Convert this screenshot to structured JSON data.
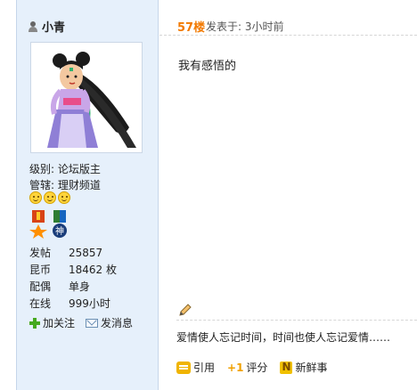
{
  "user": {
    "name": "小青",
    "level": "级别: 论坛版主",
    "manage": "管辖: 理财频道",
    "stats": [
      {
        "key": "发帖",
        "value": "25857"
      },
      {
        "key": "昆币",
        "value": "18462 枚"
      },
      {
        "key": "配偶",
        "value": "单身"
      },
      {
        "key": "在线",
        "value": "999小时"
      }
    ],
    "actions": {
      "follow": "加关注",
      "message": "发消息"
    },
    "medal_text": "神"
  },
  "post": {
    "floor": "57楼",
    "posted_time": "发表于: 3小时前",
    "content": "我有感悟的",
    "signature": "爱情使人忘记时间，时间也使人忘记爱情……",
    "actions": {
      "quote": "引用",
      "rate": "评分",
      "new": "新鲜事"
    }
  },
  "colors": {
    "floor": "#f27a00",
    "panel_bg": "#e6f0fb"
  }
}
